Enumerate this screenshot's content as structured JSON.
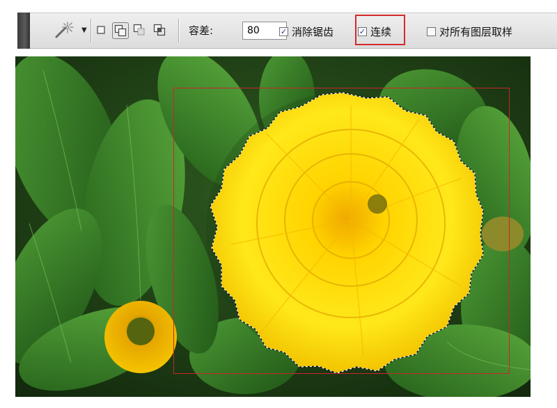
{
  "toolbar": {
    "tool_icon": "magic-wand-icon",
    "tool_preset_caret": "▼",
    "selection_modes": [
      {
        "name": "new-selection-icon",
        "active": false
      },
      {
        "name": "add-to-selection-icon",
        "active": true
      },
      {
        "name": "subtract-from-selection-icon",
        "active": false
      },
      {
        "name": "intersect-selection-icon",
        "active": false
      }
    ],
    "tolerance_label": "容差:",
    "tolerance_value": "80",
    "anti_alias": {
      "label": "消除锯齿",
      "checked": true
    },
    "contiguous": {
      "label": "连续",
      "checked": true
    },
    "sample_all_layers": {
      "label": "对所有图层取样",
      "checked": false
    }
  },
  "canvas": {
    "image_subject": "yellow-marigold-flower-selection",
    "highlight_color": "#d42a2a"
  }
}
